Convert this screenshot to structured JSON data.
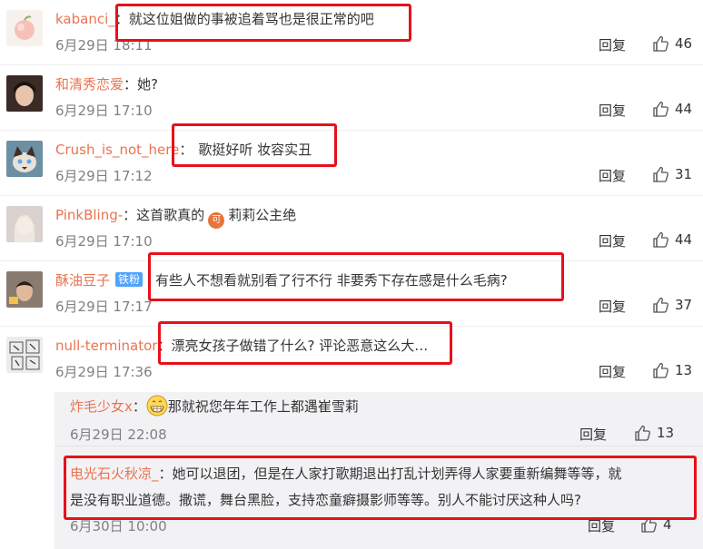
{
  "reply_label": "回复",
  "comments": [
    {
      "user": "kabanci_",
      "sep": "：",
      "text": "就这位姐做的事被追着骂也是很正常的吧",
      "time": "6月29日 18:11",
      "likes": "46"
    },
    {
      "user": "和清秀恋爱",
      "sep": "：",
      "text": "她?",
      "time": "6月29日 17:10",
      "likes": "44"
    },
    {
      "user": "Crush_is_not_here",
      "sep": "：",
      "text": "歌挺好听 妆容实丑",
      "time": "6月29日 17:12",
      "likes": "31"
    },
    {
      "user": "PinkBling-",
      "sep": "：",
      "text_a": "这首歌真的",
      "emoji_label": "可",
      "text_b": "莉莉公主绝",
      "time": "6月29日 17:10",
      "likes": "44"
    },
    {
      "user": "酥油豆子",
      "badge": "铁粉",
      "sep": "",
      "text": "有些人不想看就别看了行不行  非要秀下存在感是什么毛病?",
      "time": "6月29日 17:17",
      "likes": "37"
    },
    {
      "user": "null-terminator",
      "sep": "：",
      "text": "漂亮女孩子做错了什么? 评论恶意这么大…",
      "time": "6月29日 17:36",
      "likes": "13"
    }
  ],
  "replies": [
    {
      "user": "炸毛少女x",
      "sep": "：",
      "text": "那就祝您年年工作上都遇崔雪莉",
      "time": "6月29日 22:08",
      "likes": "13"
    },
    {
      "user": "电光石火秋凉_",
      "sep": "：",
      "text_l1": "她可以退团，但是在人家打歌期退出打乱计划弄得人家要重新编舞等等，就",
      "text_l2": "是没有职业道德。撒谎，舞台黑脸，支持恋童癖摄影师等等。别人不能讨厌这种人吗?",
      "time": "6月30日 10:00",
      "likes": "4"
    }
  ],
  "colors": {
    "username": "#eb7350",
    "highlight_box": "#e8101a",
    "reply_bg": "#f2f2f5",
    "badge": "#4fa3ff"
  }
}
